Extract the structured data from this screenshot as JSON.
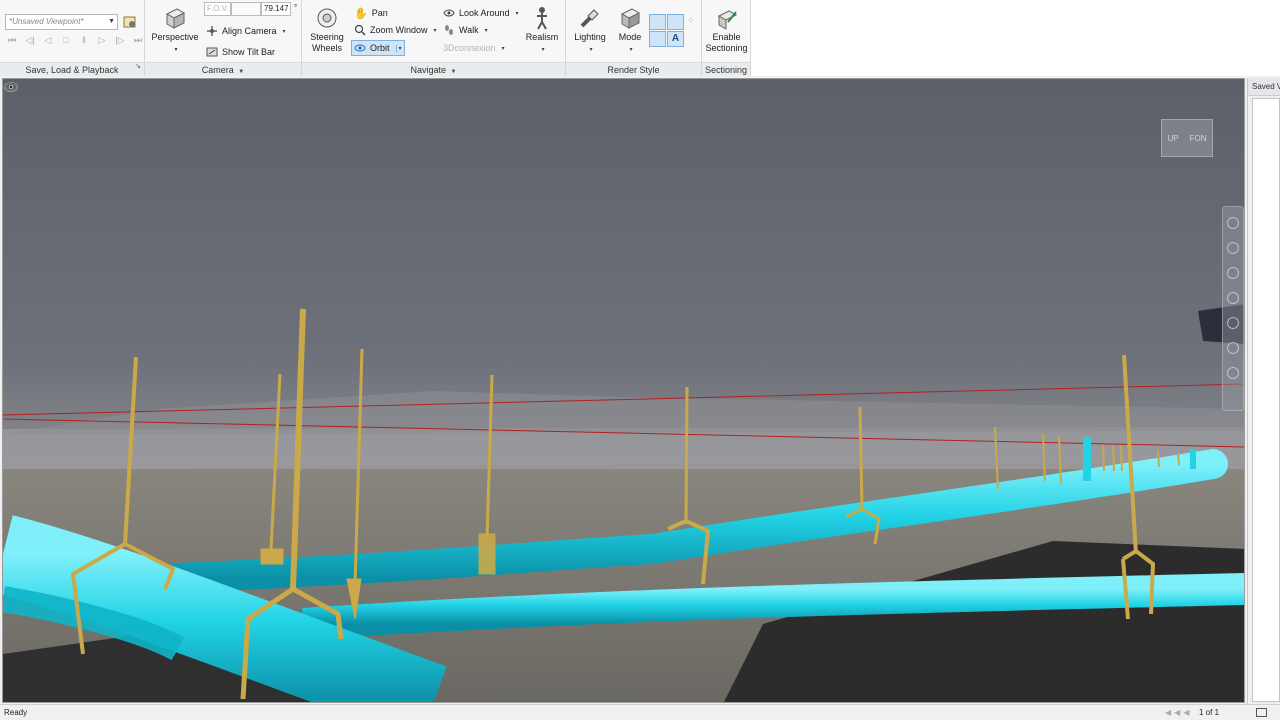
{
  "ribbon": {
    "save_load": {
      "viewpoint_value": "*Unsaved Viewpoint*",
      "title": "Save, Load & Playback",
      "playback_controls": [
        "first",
        "step-back",
        "play-back",
        "stop",
        "pause",
        "play",
        "step-forward",
        "last"
      ]
    },
    "camera": {
      "perspective_label": "Perspective",
      "fov_label": "F.O.V.",
      "fov_value": "79.147",
      "fov_unit": "°",
      "align_camera_label": "Align Camera",
      "show_tilt_bar_label": "Show Tilt Bar",
      "title": "Camera"
    },
    "navigate": {
      "steering_wheels_label": "Steering Wheels",
      "pan_label": "Pan",
      "zoom_window_label": "Zoom Window",
      "orbit_label": "Orbit",
      "look_around_label": "Look Around",
      "walk_label": "Walk",
      "connexion_label": "3Dconnexion",
      "realism_label": "Realism",
      "title": "Navigate"
    },
    "render_style": {
      "lighting_label": "Lighting",
      "mode_label": "Mode",
      "title": "Render Style",
      "text_toggle_label": "A"
    },
    "sectioning": {
      "enable_label": "Enable Sectioning",
      "title": "Sectioning"
    }
  },
  "viewport": {
    "viewcube_faces": [
      "UP",
      "FON"
    ],
    "pipe_color": "#22d3e6",
    "hanger_color": "#c9a94a",
    "background_color": "#62656d"
  },
  "side_panel": {
    "title": "Saved V"
  },
  "status_bar": {
    "status": "Ready",
    "page": "1 of 1"
  }
}
